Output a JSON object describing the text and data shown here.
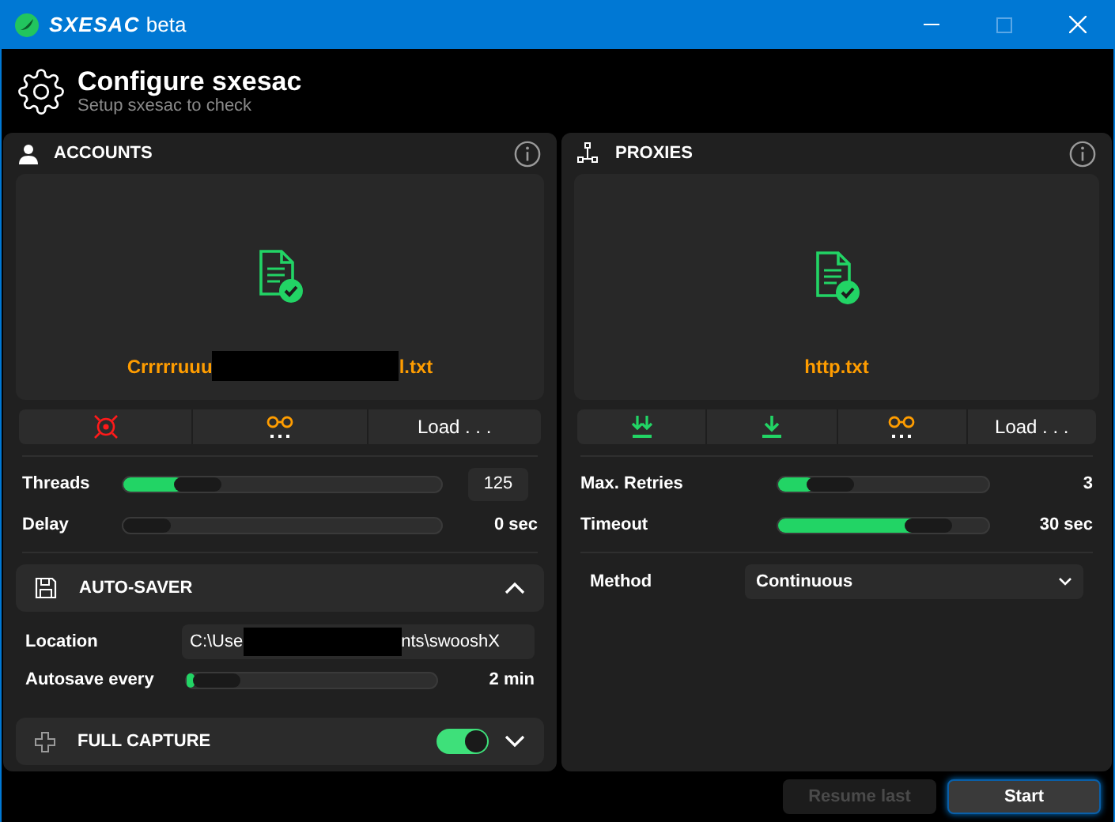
{
  "window": {
    "title_brand": "SXESAC",
    "title_suffix": "beta"
  },
  "header": {
    "title": "Configure sxesac",
    "subtitle": "Setup sxesac to check"
  },
  "accounts": {
    "title": "ACCOUNTS",
    "file": {
      "parts": [
        "Crrrrruuu",
        "l.txt"
      ]
    },
    "buttons": [
      {
        "kind": "clear"
      },
      {
        "kind": "view"
      },
      {
        "kind": "load",
        "label": "Load . . ."
      }
    ],
    "settings": [
      {
        "kind": "input",
        "label": "Threads",
        "level": 0.19,
        "reading": "125"
      },
      {
        "kind": "plain",
        "label": "Delay",
        "level": 0,
        "reading": "0 sec"
      }
    ],
    "auto_saver": {
      "title": "AUTO-SAVER",
      "expanded": true,
      "location": {
        "label": "Location",
        "parts": [
          "C:\\Use",
          "nts\\swooshX"
        ]
      },
      "autosave": {
        "label": "Autosave every",
        "level": 0.03,
        "reading": "2 min"
      }
    },
    "full_capture": {
      "title": "FULL CAPTURE",
      "on": true,
      "expanded": false
    }
  },
  "proxies": {
    "title": "PROXIES",
    "file": {
      "parts": [
        "http.txt"
      ]
    },
    "buttons": [
      {
        "kind": "download-all"
      },
      {
        "kind": "download"
      },
      {
        "kind": "view"
      },
      {
        "kind": "load",
        "label": "Load . . ."
      }
    ],
    "settings": [
      {
        "kind": "plain",
        "label": "Max. Retries",
        "level": 0.17,
        "reading": "3"
      },
      {
        "kind": "plain",
        "label": "Timeout",
        "level": 0.78,
        "reading": "30 sec"
      }
    ],
    "method": {
      "label": "Method",
      "value": "Continuous"
    }
  },
  "footer": {
    "buttons": [
      {
        "label": "Resume last",
        "disabled": true
      },
      {
        "label": "Start",
        "disabled": false
      }
    ]
  }
}
